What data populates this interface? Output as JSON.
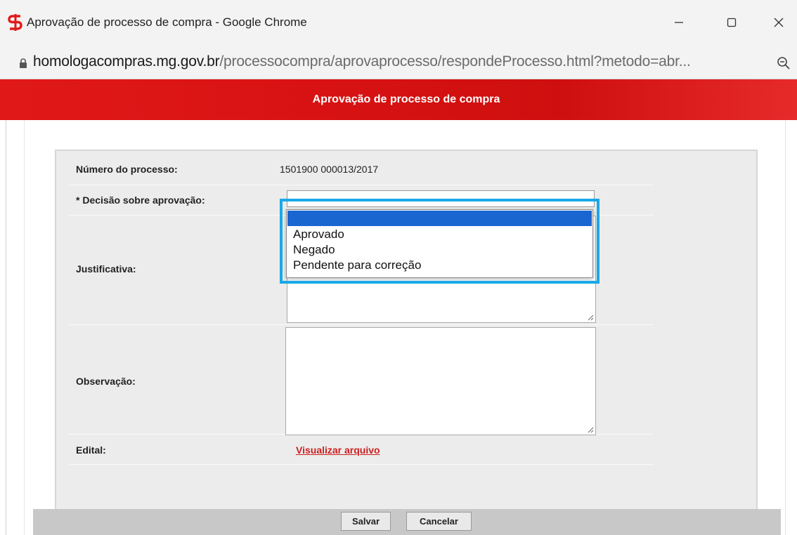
{
  "window": {
    "title": "Aprovação de processo de compra - Google Chrome",
    "controls": {
      "minimize": "minimize-icon",
      "maximize": "maximize-icon",
      "close": "close-icon"
    }
  },
  "addressbar": {
    "url_domain": "homologacompras.mg.gov.br",
    "url_path": "/processocompra/aprovaprocesso/respondeProcesso.html?metodo=abr..."
  },
  "banner": {
    "title": "Aprovação de processo de compra"
  },
  "form": {
    "numero_label": "Número do processo:",
    "numero_value": "1501900 000013/2017",
    "decisao_label": "* Decisão sobre aprovação:",
    "justificativa_label": "Justificativa:",
    "observacao_label": "Observação:",
    "edital_label": "Edital:",
    "edital_link": "Visualizar arquivo"
  },
  "dropdown": {
    "options": [
      "",
      "Aprovado",
      "Negado",
      "Pendente para correção"
    ],
    "highlighted_index": 0
  },
  "buttons": {
    "salvar": "Salvar",
    "cancelar": "Cancelar"
  },
  "colors": {
    "banner_red": "#d81212",
    "selection_blue": "#1a66d1",
    "highlight_frame": "#19a9e8",
    "link_red": "#cc1f1f"
  }
}
